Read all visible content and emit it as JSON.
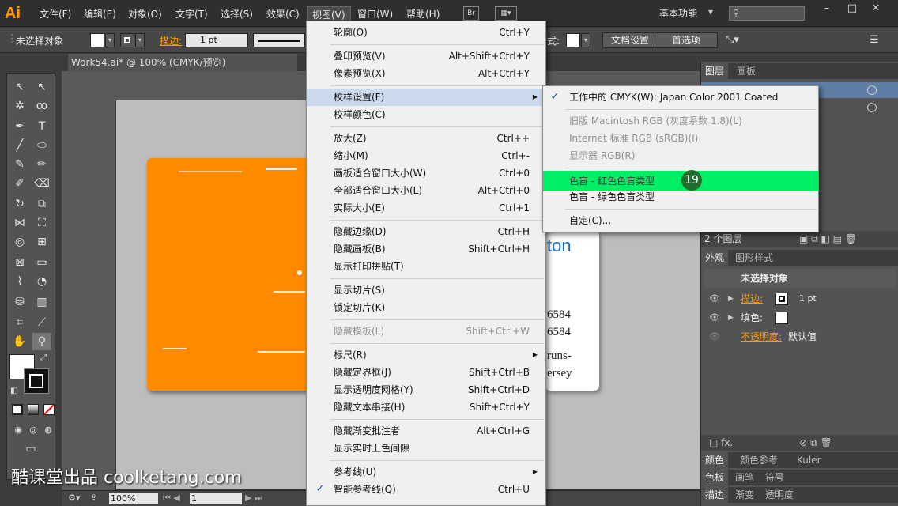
{
  "app": {
    "logo": "Ai",
    "workspace": "基本功能"
  },
  "menubar": {
    "items": [
      "文件(F)",
      "编辑(E)",
      "对象(O)",
      "文字(T)",
      "选择(S)",
      "效果(C)",
      "视图(V)",
      "窗口(W)",
      "帮助(H)"
    ],
    "bridge": "Br"
  },
  "control": {
    "selection": "未选择对象",
    "stroke_label": "描边:",
    "stroke_value": "1 pt",
    "style_label": "式:",
    "doc_settings": "文档设置",
    "preferences": "首选项"
  },
  "document": {
    "tab_title": "Work54.ai* @ 100% (CMYK/预览)"
  },
  "card": {
    "name_fragment": "ton",
    "phone1": "6584",
    "phone2": "6584",
    "line3": "runs-",
    "line4": "ersey"
  },
  "status": {
    "zoom": "100%",
    "page": "1"
  },
  "view_menu": {
    "items": [
      {
        "label": "轮廓(O)",
        "shortcut": "Ctrl+Y"
      },
      {
        "label": "叠印预览(V)",
        "shortcut": "Alt+Shift+Ctrl+Y"
      },
      {
        "label": "像素预览(X)",
        "shortcut": "Alt+Ctrl+Y"
      },
      {
        "label": "校样设置(F)",
        "shortcut": ""
      },
      {
        "label": "校样颜色(C)",
        "shortcut": ""
      },
      {
        "label": "放大(Z)",
        "shortcut": "Ctrl++"
      },
      {
        "label": "缩小(M)",
        "shortcut": "Ctrl+-"
      },
      {
        "label": "画板适合窗口大小(W)",
        "shortcut": "Ctrl+0"
      },
      {
        "label": "全部适合窗口大小(L)",
        "shortcut": "Alt+Ctrl+0"
      },
      {
        "label": "实际大小(E)",
        "shortcut": "Ctrl+1"
      },
      {
        "label": "隐藏边缘(D)",
        "shortcut": "Ctrl+H"
      },
      {
        "label": "隐藏画板(B)",
        "shortcut": "Shift+Ctrl+H"
      },
      {
        "label": "显示打印拼贴(T)",
        "shortcut": ""
      },
      {
        "label": "显示切片(S)",
        "shortcut": ""
      },
      {
        "label": "锁定切片(K)",
        "shortcut": ""
      },
      {
        "label": "隐藏模板(L)",
        "shortcut": "Shift+Ctrl+W"
      },
      {
        "label": "标尺(R)",
        "shortcut": ""
      },
      {
        "label": "隐藏定界框(J)",
        "shortcut": "Shift+Ctrl+B"
      },
      {
        "label": "显示透明度网格(Y)",
        "shortcut": "Shift+Ctrl+D"
      },
      {
        "label": "隐藏文本串接(H)",
        "shortcut": "Shift+Ctrl+Y"
      },
      {
        "label": "隐藏渐变批注者",
        "shortcut": "Alt+Ctrl+G"
      },
      {
        "label": "显示实时上色间隙",
        "shortcut": ""
      },
      {
        "label": "参考线(U)",
        "shortcut": ""
      },
      {
        "label": "智能参考线(Q)",
        "shortcut": "Ctrl+U"
      }
    ]
  },
  "proof_submenu": {
    "items": [
      {
        "label": "工作中的 CMYK(W): Japan Color 2001 Coated"
      },
      {
        "label": "旧版 Macintosh RGB (灰度系数 1.8)(L)"
      },
      {
        "label": "Internet 标准 RGB (sRGB)(I)"
      },
      {
        "label": "显示器 RGB(R)"
      },
      {
        "label": "色盲 - 红色色盲类型"
      },
      {
        "label": "色盲 - 绿色色盲类型"
      },
      {
        "label": "自定(C)..."
      }
    ],
    "step_badge": "19"
  },
  "panels": {
    "layers_tabs": [
      "图层",
      "画板"
    ],
    "layers_count": "2 个图层",
    "appearance_tabs": [
      "外观",
      "图形样式"
    ],
    "appearance_title": "未选择对象",
    "stroke_label": "描边:",
    "stroke_value": "1 pt",
    "fill_label": "填色:",
    "opacity_label": "不透明度:",
    "opacity_value": "默认值",
    "color_tabs": [
      "颜色",
      "颜色参考",
      "Kuler"
    ],
    "swatch_tabs": [
      "色板",
      "画笔",
      "符号"
    ],
    "stroke_tabs": [
      "描边",
      "渐变",
      "透明度"
    ]
  },
  "watermark": "酷课堂出品 coolketang.com"
}
